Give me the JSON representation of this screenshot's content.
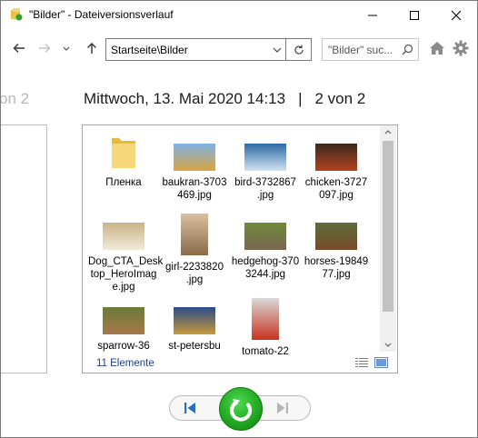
{
  "window": {
    "title": "\"Bilder\" - Dateiversionsverlauf"
  },
  "nav": {
    "address": "Startseite\\Bilder",
    "search_placeholder": "\"Bilder\" suc..."
  },
  "heading": {
    "previous_ghost": "on 2",
    "date": "Mittwoch, 13. Mai 2020 14:13",
    "separator": "|",
    "version": "2 von 2"
  },
  "files": [
    {
      "name": "Пленка",
      "icon": "folder-icon"
    },
    {
      "name": "baukran-3703469.jpg",
      "icon": "image-thumb",
      "colors": [
        "#7fb3e6",
        "#d9a441"
      ]
    },
    {
      "name": "bird-3732867.jpg",
      "icon": "image-thumb",
      "colors": [
        "#2d6aa3",
        "#cfe3f2"
      ]
    },
    {
      "name": "chicken-3727097.jpg",
      "icon": "image-thumb",
      "colors": [
        "#3a2a1e",
        "#b5421e"
      ]
    },
    {
      "name": "Dog_CTA_Desktop_HeroImage.jpg",
      "icon": "image-thumb",
      "colors": [
        "#c9b38a",
        "#f1ead9"
      ]
    },
    {
      "name": "girl-2233820.jpg",
      "icon": "image-thumb",
      "colors": [
        "#d8c0a0",
        "#8a6a4a"
      ]
    },
    {
      "name": "hedgehog-3703244.jpg",
      "icon": "image-thumb",
      "colors": [
        "#6f8a3a",
        "#7a6650"
      ]
    },
    {
      "name": "horses-1984977.jpg",
      "icon": "image-thumb",
      "colors": [
        "#5b6e3a",
        "#7a4a2a"
      ]
    },
    {
      "name": "sparrow-36",
      "icon": "image-thumb",
      "colors": [
        "#6c7a3a",
        "#a6794a"
      ]
    },
    {
      "name": "st-petersbu",
      "icon": "image-thumb",
      "colors": [
        "#2a4a8a",
        "#c89a3a"
      ]
    },
    {
      "name": "tomato-22",
      "icon": "image-thumb",
      "colors": [
        "#d9d9d9",
        "#c8321e"
      ]
    }
  ],
  "status": {
    "count": "11 Elemente"
  },
  "colors": {
    "accent_green": "#1fa51f",
    "status_blue": "#1c3f94",
    "first_arrow": "#2b6fbf"
  }
}
